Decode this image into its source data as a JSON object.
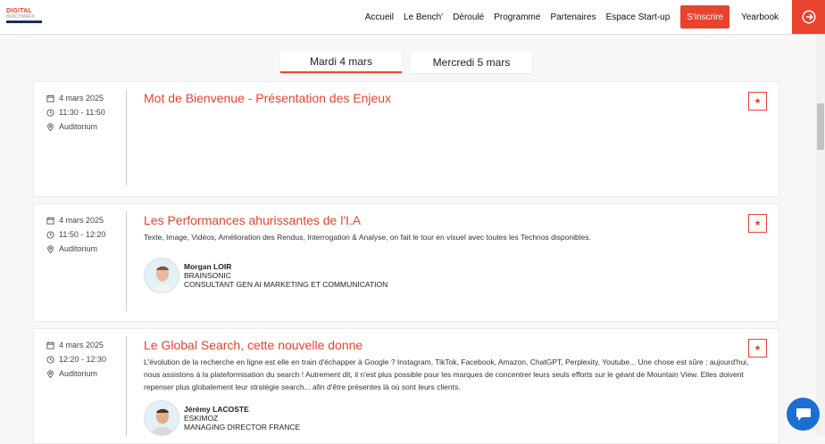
{
  "header": {
    "logo_line1": "DIGITAL",
    "logo_line2": "BENCHMARK",
    "nav": [
      "Accueil",
      "Le Bench'",
      "Déroulé",
      "Programme",
      "Partenaires",
      "Espace Start-up"
    ],
    "cta": "S'inscrire",
    "yearbook": "Yearbook"
  },
  "tabs": [
    {
      "label": "Mardi 4 mars",
      "active": true
    },
    {
      "label": "Mercredi 5 mars",
      "active": false
    }
  ],
  "sessions": [
    {
      "date": "4 mars 2025",
      "time": "11:30 - 11:50",
      "room": "Auditorium",
      "title": "Mot de Bienvenue - Présentation des Enjeux",
      "description": "",
      "fav": "★"
    },
    {
      "date": "4 mars 2025",
      "time": "11:50 - 12:20",
      "room": "Auditorium",
      "title": "Les Performances ahurissantes de l'I.A",
      "description": "Texte, Image, Vidéos, Amélioration des Rendus, Interrogation & Analyse, on fait le tour en visuel avec toutes les Technos disponibles.",
      "speaker": {
        "name": "Morgan LOIR",
        "company": "BRAINSONIC",
        "role": "CONSULTANT GEN AI MARKETING ET COMMUNICATION"
      },
      "fav": "★"
    },
    {
      "date": "4 mars 2025",
      "time": "12:20 - 12:30",
      "room": "Auditorium",
      "title": "Le Global Search, cette nouvelle donne",
      "description": "L'évolution de la recherche en ligne est elle en train d'échapper à Google ? Instagram, TikTok, Facebook, Amazon, ChatGPT, Perplexity, Youtube... Une chose est sûre : aujourd'hui, nous assistons à la plateformisation du search ! Autrement dit, il n'est plus possible pour les marques de concentrer leurs seuls efforts sur le géant de Mountain View. Elles doivent repenser plus globalement leur stratégie search... afin d'être présentes là où sont leurs clients.",
      "speaker": {
        "name": "Jérémy LACOSTE",
        "company": "ESKIMOZ",
        "role": "MANAGING DIRECTOR FRANCE"
      },
      "fav": "★"
    }
  ],
  "colors": {
    "accent": "#e8432e",
    "chat": "#1a6fd1"
  }
}
